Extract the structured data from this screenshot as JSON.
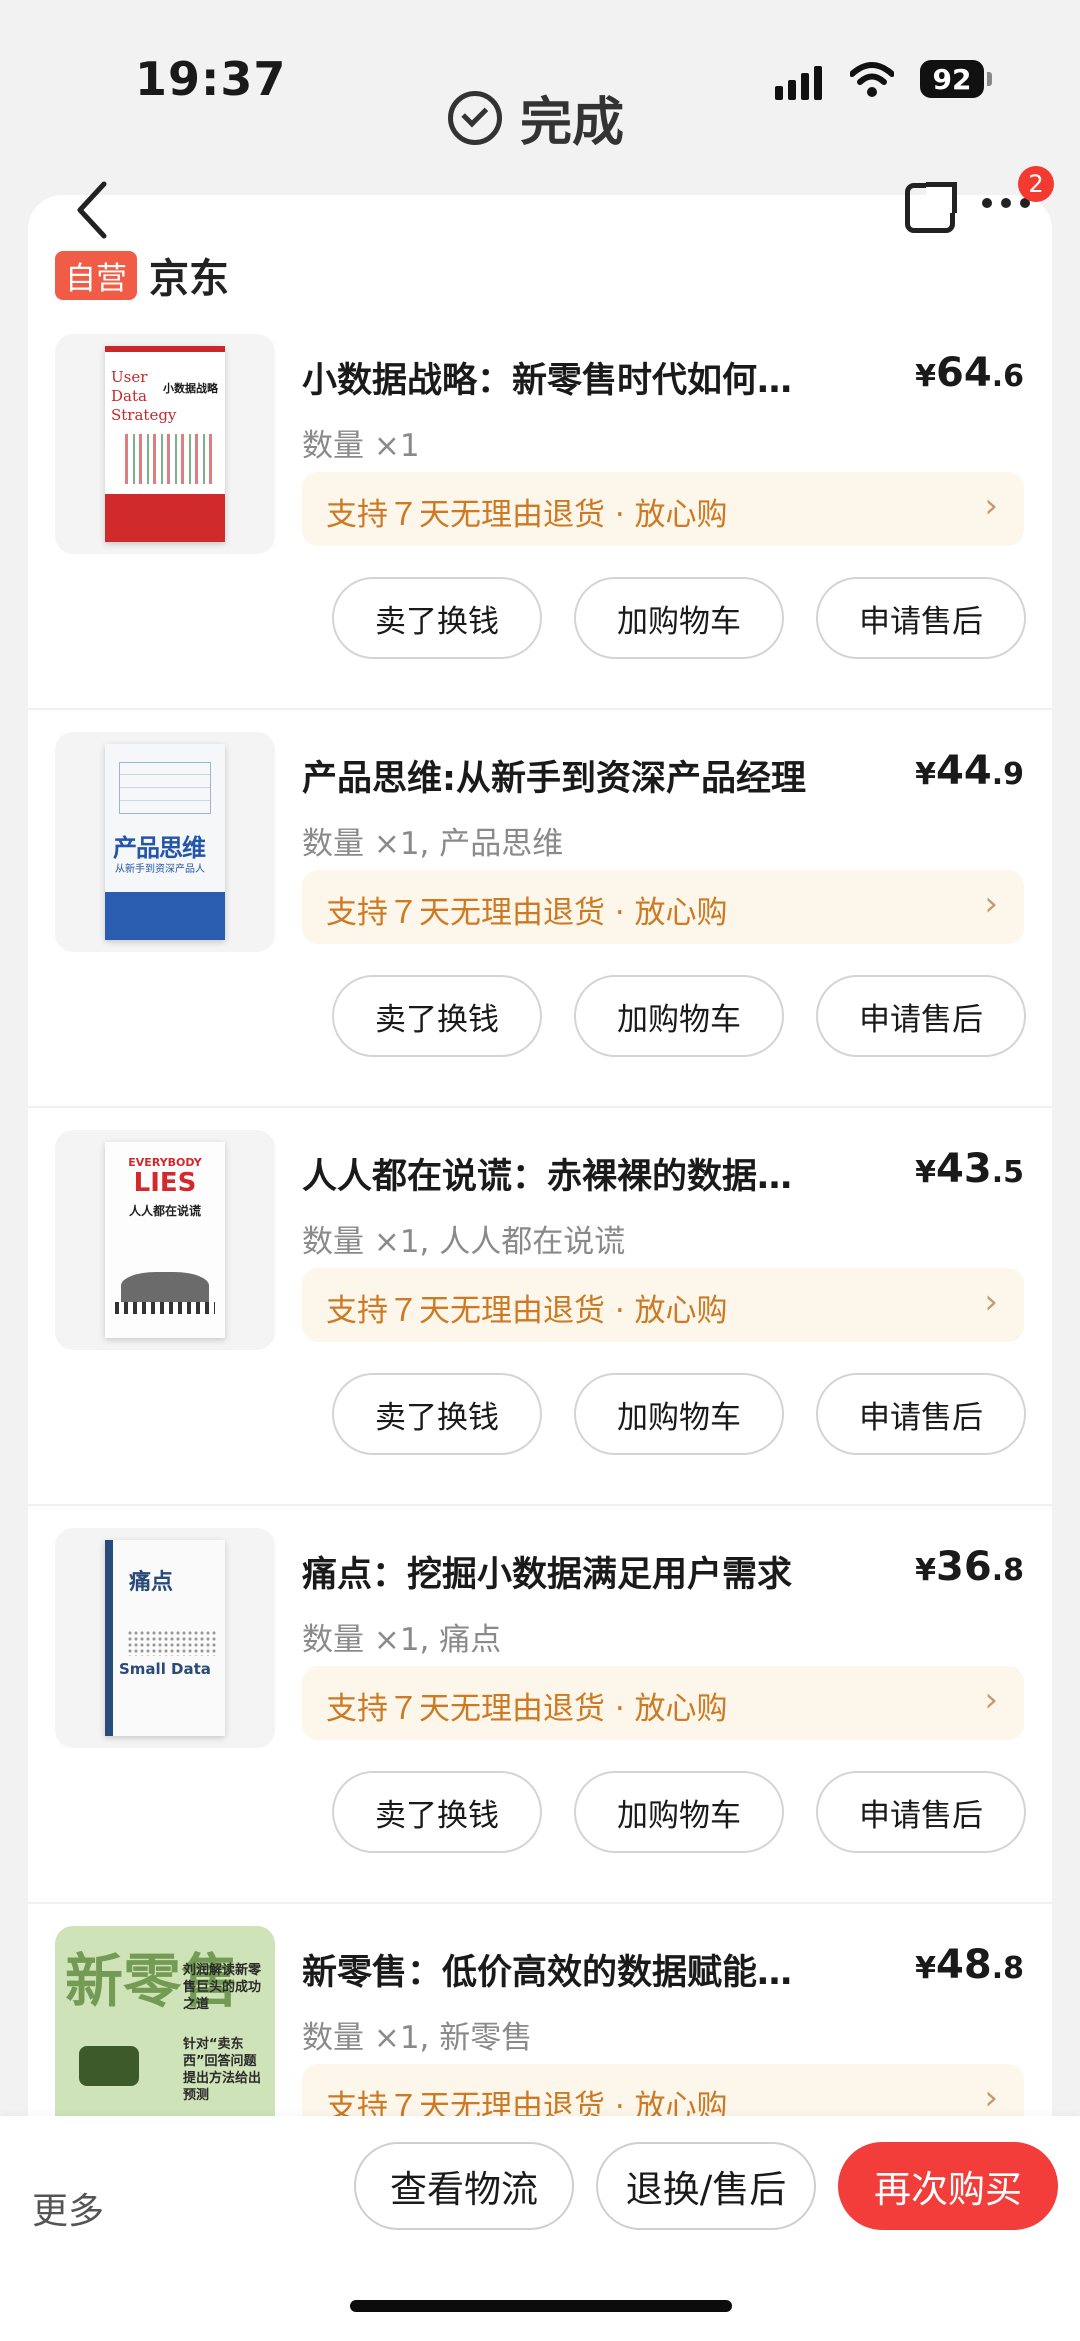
{
  "status_bar": {
    "time": "19:37",
    "done_label": "完成",
    "battery": "92"
  },
  "header": {
    "notification_count": "2"
  },
  "shop": {
    "tag": "自营",
    "name": "京东"
  },
  "items": [
    {
      "title": "小数据战略：新零售时代如何…",
      "price_currency": "¥",
      "price_int": "64",
      "price_dec": ".6",
      "qty": "数量 ×1",
      "return_text": "支持７天无理由退货 · 放心购",
      "cover": {
        "line1": "User",
        "line2": "Data",
        "line3": "Strategy",
        "title": "小数据战略"
      }
    },
    {
      "title": "产品思维:从新手到资深产品经理",
      "price_currency": "¥",
      "price_int": "44",
      "price_dec": ".9",
      "qty": "数量 ×1, 产品思维",
      "return_text": "支持７天无理由退货 · 放心购",
      "cover": {
        "title": "产品思维",
        "subtitle": "从新手到资深产品人"
      }
    },
    {
      "title": "人人都在说谎：赤裸裸的数据…",
      "price_currency": "¥",
      "price_int": "43",
      "price_dec": ".5",
      "qty": "数量 ×1, 人人都在说谎",
      "return_text": "支持７天无理由退货 · 放心购",
      "cover": {
        "line1": "EVERYBODY",
        "line2": "LIES",
        "title": "人人都在说谎"
      }
    },
    {
      "title": "痛点：挖掘小数据满足用户需求",
      "price_currency": "¥",
      "price_int": "36",
      "price_dec": ".8",
      "qty": "数量 ×1, 痛点",
      "return_text": "支持７天无理由退货 · 放心购",
      "cover": {
        "title": "痛点",
        "en": "Small Data"
      }
    },
    {
      "title": "新零售：低价高效的数据赋能…",
      "price_currency": "¥",
      "price_int": "48",
      "price_dec": ".8",
      "qty": "数量 ×1, 新零售",
      "return_text": "支持７天无理由退货 · 放心购",
      "cover": {
        "title": "新零售",
        "note1": "刘润解读新零售巨头的成功之道",
        "note2": "针对“卖东西”回答问题提出方法给出预测"
      }
    }
  ],
  "item_buttons": {
    "sell": "卖了换钱",
    "cart": "加购物车",
    "after": "申请售后"
  },
  "bottom_bar": {
    "more": "更多",
    "logistics": "查看物流",
    "return": "退换/售后",
    "rebuy": "再次购买"
  },
  "colors": {
    "accent_red": "#f23d3a",
    "return_text": "#cc7a24",
    "return_bg": "#fdf6ea",
    "self_tag": "#f15c46"
  },
  "icons": [
    "back-icon",
    "share-icon",
    "more-icon",
    "check-circle-icon",
    "chevron-right-icon",
    "signal-icon",
    "wifi-icon",
    "battery-icon"
  ]
}
